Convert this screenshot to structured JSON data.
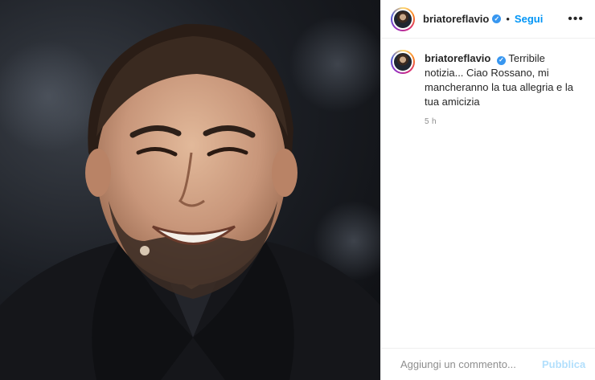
{
  "post": {
    "author": {
      "username": "briatoreflavio",
      "verified_icon": "verified-badge-icon",
      "separator": "•",
      "follow_label": "Segui",
      "more_icon": "more-options-icon",
      "more_glyph": "•••"
    },
    "caption": {
      "username": "briatoreflavio",
      "text": "Terribile notizia... Ciao Rossano, mi mancheranno la tua allegria e la tua amicizia",
      "time_ago": "5 h"
    },
    "comment_box": {
      "emoji_icon": "emoji-icon",
      "placeholder": "Aggiungi un commento...",
      "publish_label": "Pubblica"
    },
    "colors": {
      "link_blue": "#0095f6",
      "publish_disabled": "#b2dffc",
      "verified_blue": "#3897f0",
      "text_secondary": "#8e8e8e"
    }
  }
}
